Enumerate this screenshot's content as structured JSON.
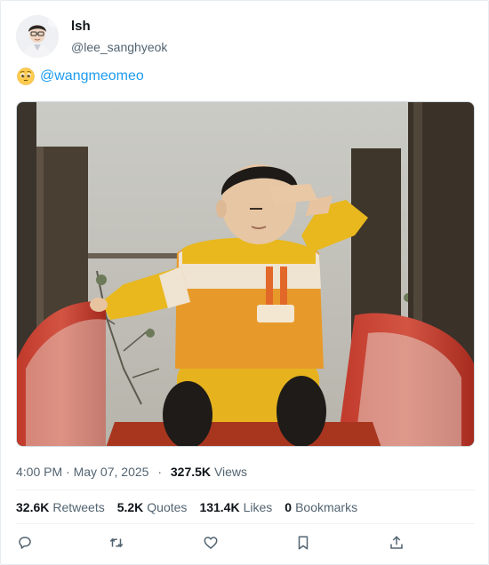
{
  "user": {
    "display_name": "lsh",
    "handle": "@lee_sanghyeok"
  },
  "tweet": {
    "emoji": "pleading-face",
    "mention": "@wangmeomeo",
    "image_alt": "child in yellow and white outfit saluting on a red slide"
  },
  "meta": {
    "time": "4:00 PM",
    "date_sep": "·",
    "date": "May 07, 2025",
    "dot": "·",
    "views_count": "327.5K",
    "views_label": "Views"
  },
  "stats": [
    {
      "count": "32.6K",
      "label": "Retweets"
    },
    {
      "count": "5.2K",
      "label": "Quotes"
    },
    {
      "count": "131.4K",
      "label": "Likes"
    },
    {
      "count": "0",
      "label": "Bookmarks"
    }
  ],
  "actions": [
    {
      "icon": "reply-icon"
    },
    {
      "icon": "retweet-icon"
    },
    {
      "icon": "like-icon"
    },
    {
      "icon": "bookmark-icon"
    },
    {
      "icon": "share-icon"
    }
  ],
  "colors": {
    "accent": "#1d9bf0",
    "text": "#0f1419",
    "muted": "#536471",
    "border": "#eff3f4"
  }
}
